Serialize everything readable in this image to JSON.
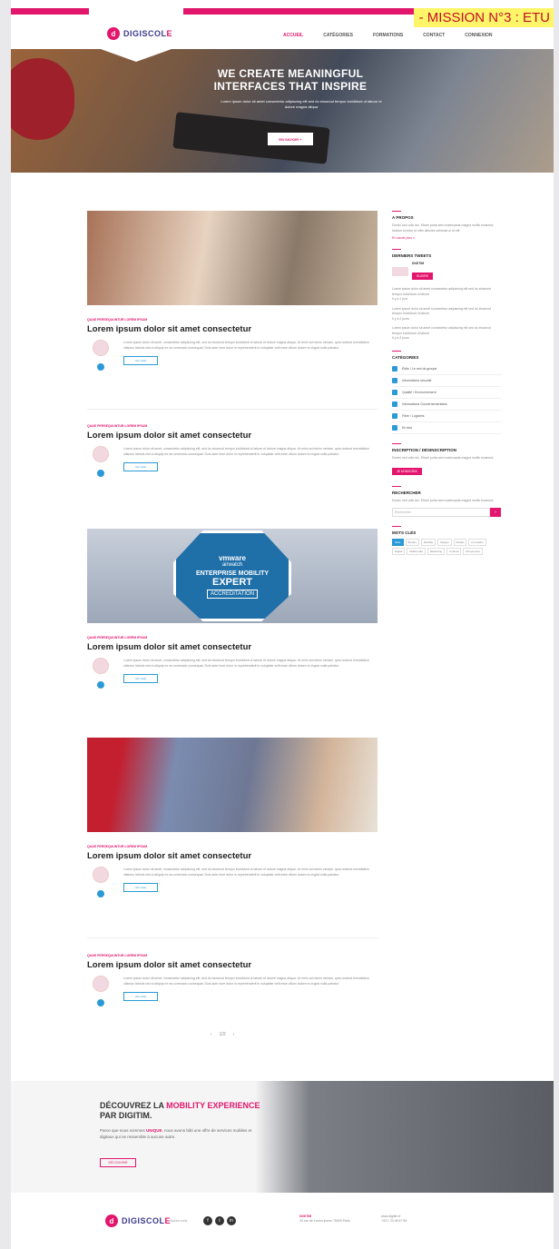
{
  "header": {
    "mission_label": "- MISSION N°3 : ETU",
    "logo_mark": "d",
    "logo_text_a": "DIGISCOL",
    "logo_text_b": "E",
    "nav_items": [
      "Accueil",
      "Catégories",
      "Formations",
      "Contact",
      "Connexion"
    ]
  },
  "hero": {
    "title": "WE CREATE MEANINGFUL INTERFACES THAT INSPIRE",
    "subtitle": "Lorem ipsum dolor sit amet consectetur adipiscing elit sed do eiusmod tempor incididunt ut labore et dolore magna aliqua",
    "button": "EN SAVOIR +"
  },
  "posts": [
    {
      "category": "Quae persequuntur lorem ipsum",
      "title": "Lorem ipsum dolor sit amet consectetur",
      "body": "Lorem ipsum dolor sit amet, consectetur adipiscing elit, sed do eiusmod tempor incididunt ut labore et dolore magna aliqua. Ut enim ad minim veniam, quis nostrud exercitation ullamco laboris nisi ut aliquip ex ea commodo consequat. Duis aute irure dolor in reprehenderit in voluptate velit esse cillum dolore eu fugiat nulla pariatur.",
      "more": "Voir suite"
    },
    {
      "category": "Quae persequuntur lorem ipsum",
      "title": "Lorem ipsum dolor sit amet consectetur",
      "body": "Lorem ipsum dolor sit amet, consectetur adipiscing elit, sed do eiusmod tempor incididunt ut labore et dolore magna aliqua. Ut enim ad minim veniam, quis nostrud exercitation ullamco laboris nisi ut aliquip ex ea commodo consequat. Duis aute irure dolor in reprehenderit in voluptate velit esse cillum dolore eu fugiat nulla pariatur.",
      "more": "Voir suite"
    },
    {
      "category": "Quae persequuntur lorem ipsum",
      "title": "Lorem ipsum dolor sit amet consectetur",
      "body": "Lorem ipsum dolor sit amet, consectetur adipiscing elit, sed do eiusmod tempor incididunt ut labore et dolore magna aliqua. Ut enim ad minim veniam, quis nostrud exercitation ullamco laboris nisi ut aliquip ex ea commodo consequat. Duis aute irure dolor in reprehenderit in voluptate velit esse cillum dolore eu fugiat nulla pariatur.",
      "more": "Voir suite"
    },
    {
      "category": "Quae persequuntur lorem ipsum",
      "title": "Lorem ipsum dolor sit amet consectetur",
      "body": "Lorem ipsum dolor sit amet, consectetur adipiscing elit, sed do eiusmod tempor incididunt ut labore et dolore magna aliqua. Ut enim ad minim veniam, quis nostrud exercitation ullamco laboris nisi ut aliquip ex ea commodo consequat. Duis aute irure dolor in reprehenderit in voluptate velit esse cillum dolore eu fugiat nulla pariatur.",
      "more": "Voir suite"
    },
    {
      "category": "Quae persequuntur lorem ipsum",
      "title": "Lorem ipsum dolor sit amet consectetur",
      "body": "Lorem ipsum dolor sit amet, consectetur adipiscing elit, sed do eiusmod tempor incididunt ut labore et dolore magna aliqua. Ut enim ad minim veniam, quis nostrud exercitation ullamco laboris nisi ut aliquip ex ea commodo consequat. Duis aute irure dolor in reprehenderit in voluptate velit esse cillum dolore eu fugiat nulla pariatur.",
      "more": "Voir suite"
    }
  ],
  "accreditation": {
    "brand": "vmware",
    "sub": "airwatch",
    "line1": "ENTERPRISE MOBILITY",
    "line2": "EXPERT",
    "line3": "ACCREDITATION"
  },
  "pagination": {
    "prev": "‹",
    "current": "1/2",
    "next": "›"
  },
  "sidebar": {
    "about": {
      "title": "A PROPOS",
      "text": "Donec sed odio dui. Etiam porta sem malesuada magna mollis euismod. Nullam id dolor id nibh ultricies vehicula ut id elit.",
      "link": "En savoir plus »"
    },
    "tweets": {
      "title": "DERNIERS TWEETS",
      "handle": "DIGITIM",
      "follow": "SUIVRE",
      "items": [
        {
          "text": "Lorem ipsum dolor sit amet consectetur adipiscing elit sed do eiusmod tempor incididunt ut labore",
          "time": "Il y a 1 jour"
        },
        {
          "text": "Lorem ipsum dolor sit amet consectetur adipiscing elit sed do eiusmod tempor incididunt ut labore",
          "time": "Il y a 2 jours"
        },
        {
          "text": "Lorem ipsum dolor sit amet consectetur adipiscing elit sed do eiusmod tempor incididunt ut labore",
          "time": "Il y a 3 jours"
        }
      ]
    },
    "categories": {
      "title": "CATÉGORIES",
      "items": [
        "Édito / Le mot du groupe",
        "Informations sécurité",
        "Qualité / Environnement",
        "Informations Gouvernementales",
        "Fibre / Logiciels",
        "En test"
      ]
    },
    "newsletter": {
      "title": "INSCRIPTION / DÉSINSCRIPTION",
      "text": "Donec sed odio dui. Etiam porta sem malesuada magna mollis euismod.",
      "button": "JE M'INSCRIS"
    },
    "search": {
      "title": "RECHERCHER",
      "text": "Donec sed odio dui. Etiam porta sem malesuada magna mollis euismod.",
      "placeholder": "Rechercher",
      "go": "›"
    },
    "tags": {
      "title": "MOTS CLÉS",
      "items": [
        "Mots",
        "Études",
        "Mobilité",
        "Design",
        "Mobile",
        "Formation",
        "Digital",
        "Multimedia",
        "Marketing",
        "Android",
        "Responsive"
      ]
    }
  },
  "promo": {
    "line1": "DÉCOUVREZ LA ",
    "line1_bold": "MOBILITY EXPERIENCE",
    "line2": "PAR DIGITIM.",
    "text_a": "Parce que nous sommes ",
    "text_bold": "UNIQUE",
    "text_b": ", nous avons bâti une offre de services mobiles et digitaux qui ne ressemble à aucune autre.",
    "button": "DÉCOUVRIR"
  },
  "footer": {
    "follow": "Suivez-nous",
    "col1_title": "DIGITIM",
    "col1_text": "33 rue de Lorem ipsum 75000 Paris",
    "col2_text": "www.digitim.fr",
    "col2_sub": "+33 1 23 45 67 89"
  }
}
